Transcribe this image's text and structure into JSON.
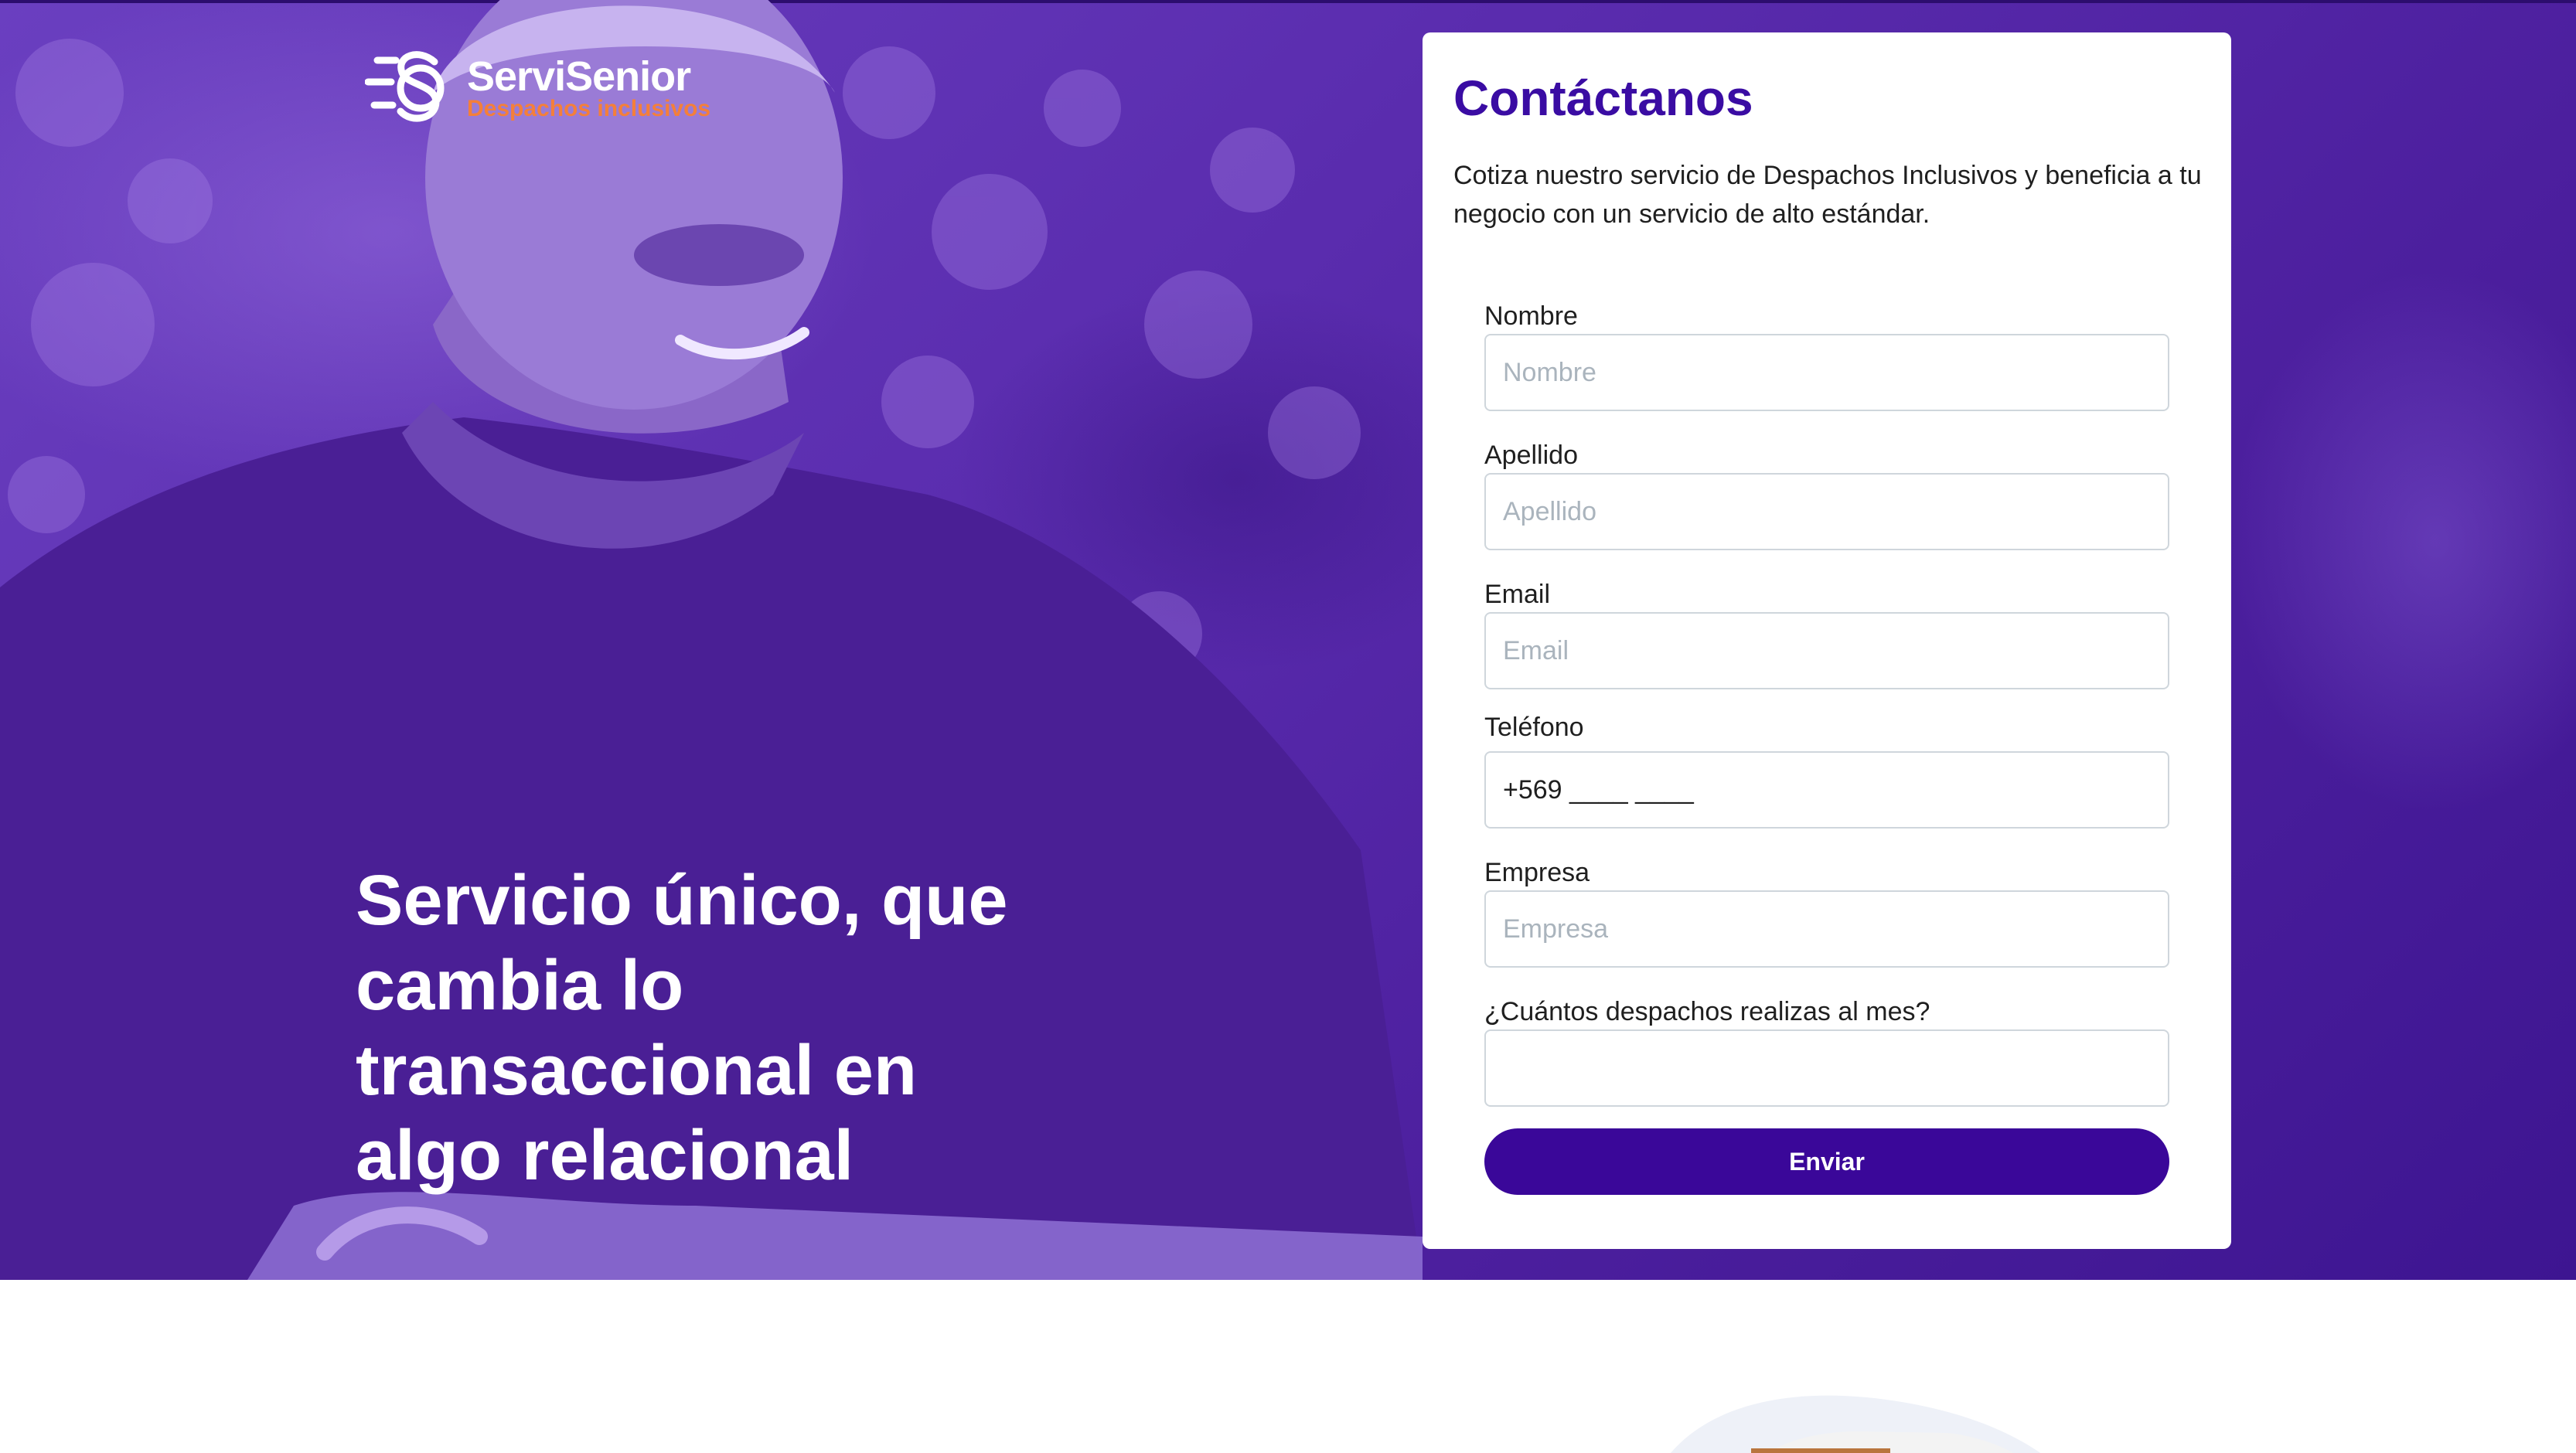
{
  "brand": {
    "name": "ServiSenior",
    "tagline": "Despachos inclusivos",
    "primary_color": "#3a0ca3",
    "accent_color": "#f47f3a",
    "hero_overlay_color": "#5a2cae"
  },
  "hero": {
    "headline": "Servicio único, que cambia lo transaccional en algo relacional"
  },
  "contact_form": {
    "title": "Contáctanos",
    "intro": "Cotiza nuestro servicio de Despachos Inclusivos y beneficia a tu negocio con un servicio de alto estándar.",
    "fields": {
      "nombre": {
        "label": "Nombre",
        "placeholder": "Nombre",
        "value": ""
      },
      "apellido": {
        "label": "Apellido",
        "placeholder": "Apellido",
        "value": ""
      },
      "email": {
        "label": "Email",
        "placeholder": "Email",
        "value": ""
      },
      "telefono": {
        "label": "Teléfono",
        "placeholder": "",
        "value": "+569 ____ ____"
      },
      "empresa": {
        "label": "Empresa",
        "placeholder": "Empresa",
        "value": ""
      },
      "despachos": {
        "label": "¿Cuántos despachos realizas al mes?",
        "placeholder": "",
        "value": ""
      }
    },
    "submit_label": "Enviar"
  }
}
